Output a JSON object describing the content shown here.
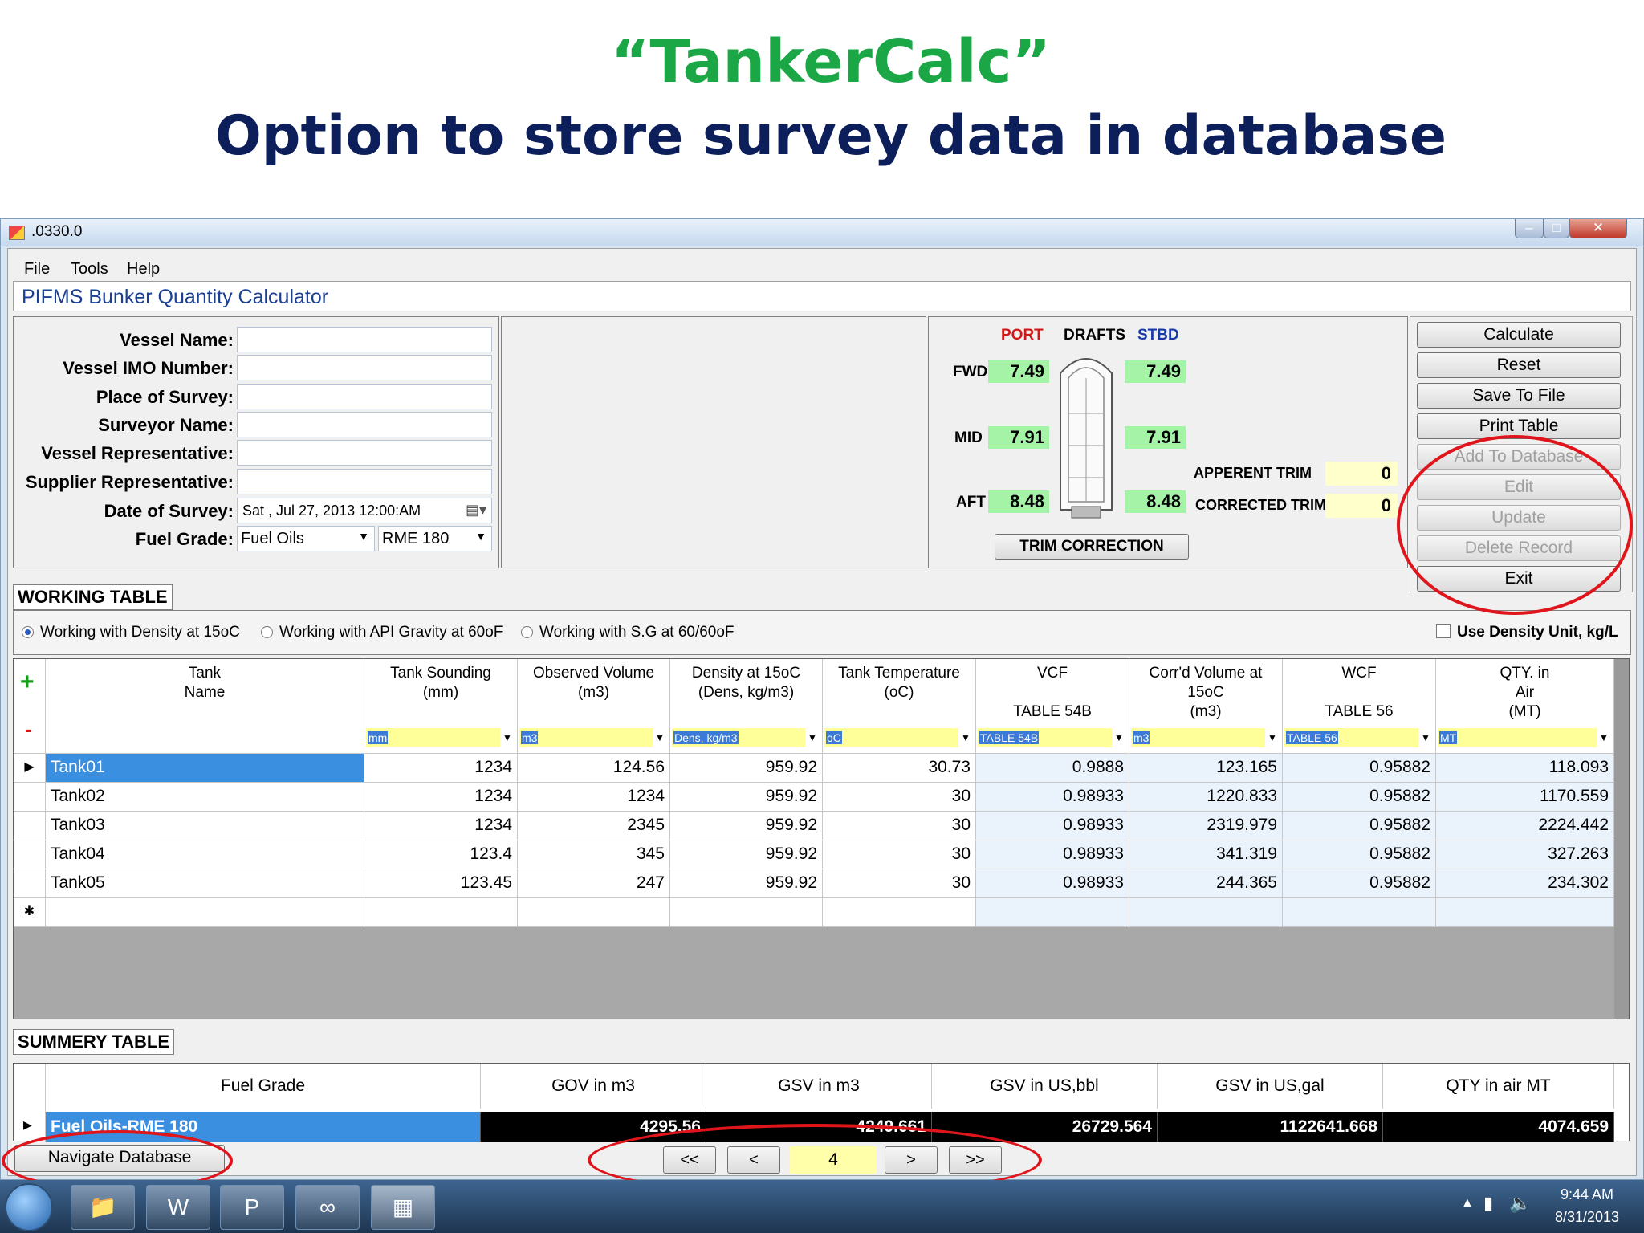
{
  "slide": {
    "title": "“TankerCalc”",
    "subtitle": "Option to store survey data in database"
  },
  "window": {
    "title": ".0330.0"
  },
  "menu": [
    "File",
    "Tools",
    "Help"
  ],
  "app_title": "PIFMS Bunker Quantity Calculator",
  "form": {
    "vessel_name": "Vessel Name:",
    "vessel_imo": "Vessel IMO Number:",
    "place": "Place of Survey:",
    "surveyor": "Surveyor Name:",
    "vessel_rep": "Vessel Representative:",
    "supplier_rep": "Supplier Representative:",
    "date_label": "Date of Survey:",
    "date_value": "Sat ,  Jul  27, 2013 12:00:AM",
    "fuel_label": "Fuel Grade:",
    "fuel_type": "Fuel Oils",
    "fuel_grade": "RME 180"
  },
  "drafts": {
    "port": "PORT",
    "drafts": "DRAFTS",
    "stbd": "STBD",
    "fwd": "FWD",
    "mid": "MID",
    "aft": "AFT",
    "fwd_port": "7.49",
    "fwd_stbd": "7.49",
    "mid_port": "7.91",
    "mid_stbd": "7.91",
    "aft_port": "8.48",
    "aft_stbd": "8.48",
    "apparent_trim_label": "APPERENT TRIM",
    "apparent_trim": "0",
    "corrected_trim_label": "CORRECTED TRIM",
    "corrected_trim": "0",
    "trim_button": "TRIM CORRECTION"
  },
  "buttons": {
    "calculate": "Calculate",
    "reset": "Reset",
    "save": "Save To File",
    "print": "Print Table",
    "add_db": "Add To Database",
    "edit": "Edit",
    "update": "Update",
    "delete": "Delete Record",
    "exit": "Exit"
  },
  "working_table": {
    "label": "WORKING TABLE",
    "radio1": "Working with Density at 15oC",
    "radio2": "Working with API Gravity at 60oF",
    "radio3": "Working with S.G at 60/60oF",
    "density_unit": "Use Density Unit, kg/L",
    "plus": "+",
    "minus": "-",
    "headers": [
      "Tank\nName",
      "Tank Sounding\n(mm)",
      "Observed Volume\n(m3)",
      "Density at 15oC\n(Dens, kg/m3)",
      "Tank Temperature\n(oC)",
      "VCF\n\nTABLE 54B",
      "Corr'd Volume at\n15oC\n(m3)",
      "WCF\n\nTABLE 56",
      "QTY. in\nAir\n(MT)"
    ],
    "units": [
      "mm",
      "m3",
      "Dens, kg/m3",
      "oC",
      "TABLE 54B",
      "m3",
      "TABLE 56",
      "MT"
    ],
    "rows": [
      [
        "Tank01",
        "1234",
        "124.56",
        "959.92",
        "30.73",
        "0.9888",
        "123.165",
        "0.95882",
        "118.093"
      ],
      [
        "Tank02",
        "1234",
        "1234",
        "959.92",
        "30",
        "0.98933",
        "1220.833",
        "0.95882",
        "1170.559"
      ],
      [
        "Tank03",
        "1234",
        "2345",
        "959.92",
        "30",
        "0.98933",
        "2319.979",
        "0.95882",
        "2224.442"
      ],
      [
        "Tank04",
        "123.4",
        "345",
        "959.92",
        "30",
        "0.98933",
        "341.319",
        "0.95882",
        "327.263"
      ],
      [
        "Tank05",
        "123.45",
        "247",
        "959.92",
        "30",
        "0.98933",
        "244.365",
        "0.95882",
        "234.302"
      ]
    ]
  },
  "summary_table": {
    "label": "SUMMERY TABLE",
    "headers": [
      "Fuel Grade",
      "GOV in m3",
      "GSV in m3",
      "GSV in US,bbl",
      "GSV in US,gal",
      "QTY in air MT"
    ],
    "row": [
      "Fuel Oils-RME 180",
      "4295.56",
      "4249.661",
      "26729.564",
      "1122641.668",
      "4074.659"
    ]
  },
  "navigation": {
    "navigate_db": "Navigate Database",
    "first": "<<",
    "prev": "<",
    "record": "4",
    "next": ">",
    "last": ">>"
  },
  "taskbar": {
    "time": "9:44 AM",
    "date": "8/31/2013"
  },
  "colors": {
    "title_green": "#1ba745",
    "subtitle_navy": "#0d1f5b",
    "highlight_red": "#e0151b",
    "draft_green": "#a5f3a6"
  }
}
